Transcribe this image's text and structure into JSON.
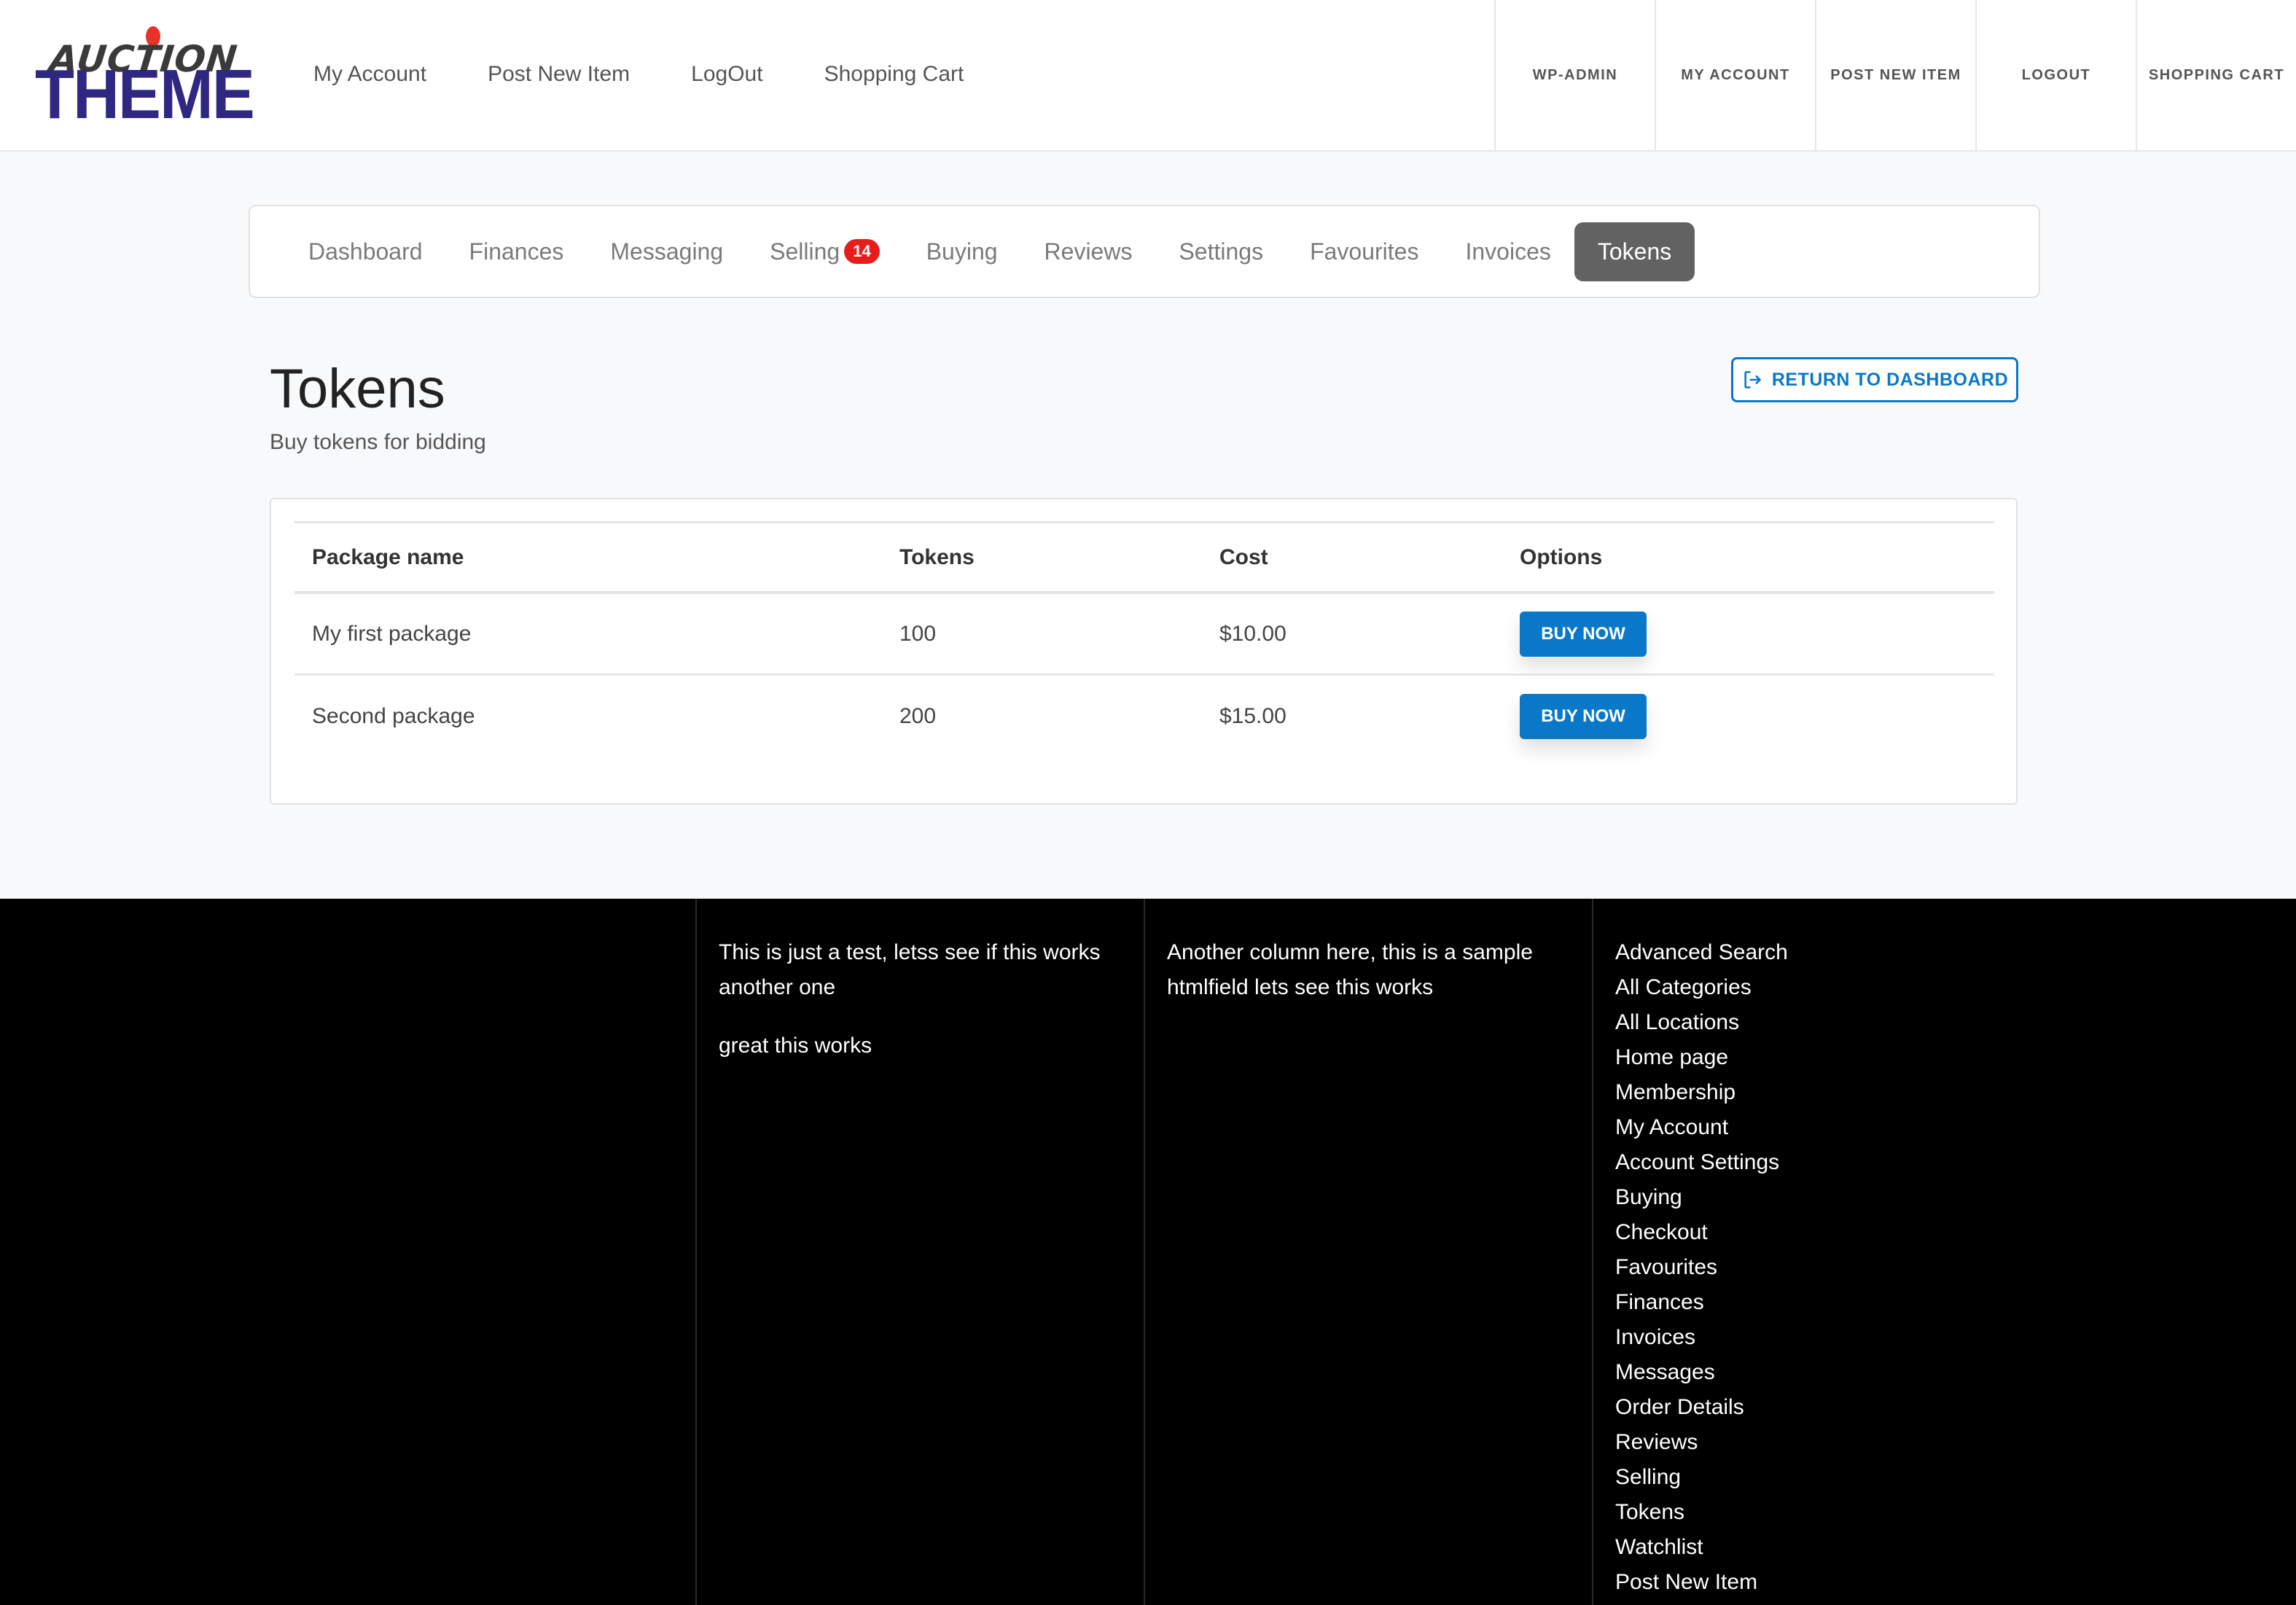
{
  "header": {
    "logo": {
      "top_text": "AUCTION",
      "bottom_text": "THEME",
      "accent_dot_color": "#e8322a",
      "brand_color": "#2f2782"
    },
    "main_links": [
      "My Account",
      "Post New Item",
      "LogOut",
      "Shopping Cart"
    ],
    "top_links": [
      "WP-ADMIN",
      "MY ACCOUNT",
      "POST NEW ITEM",
      "LOGOUT",
      "SHOPPING CART"
    ]
  },
  "tabs": {
    "items": [
      {
        "label": "Dashboard"
      },
      {
        "label": "Finances"
      },
      {
        "label": "Messaging"
      },
      {
        "label": "Selling",
        "badge": "14"
      },
      {
        "label": "Buying"
      },
      {
        "label": "Reviews"
      },
      {
        "label": "Settings"
      },
      {
        "label": "Favourites"
      },
      {
        "label": "Invoices"
      },
      {
        "label": "Tokens",
        "active": true
      }
    ],
    "active_color": "#626262",
    "badge_color": "#e71d1d"
  },
  "page": {
    "title": "Tokens",
    "subtitle": "Buy tokens for bidding",
    "return_button": "RETURN TO DASHBOARD",
    "return_icon": "sign-out-icon"
  },
  "table": {
    "columns": [
      "Package name",
      "Tokens",
      "Cost",
      "Options"
    ],
    "rows": [
      {
        "name": "My first package",
        "tokens": "100",
        "cost": "$10.00",
        "action": "BUY NOW"
      },
      {
        "name": "Second package",
        "tokens": "200",
        "cost": "$15.00",
        "action": "BUY NOW"
      }
    ],
    "button_color": "#0a78c8"
  },
  "footer": {
    "col1": {
      "paragraphs": [
        "This is just a test, letss see if this works another one",
        "great this works"
      ]
    },
    "col2": {
      "paragraphs": [
        "Another column here, this is a sample htmlfield lets see this works"
      ]
    },
    "col3": {
      "links": [
        "Advanced Search",
        "All Categories",
        "All Locations",
        "Home page",
        "Membership",
        "My Account",
        "Account Settings",
        "Buying",
        "Checkout",
        "Favourites",
        "Finances",
        "Invoices",
        "Messages",
        "Order Details",
        "Reviews",
        "Selling",
        "Tokens",
        "Watchlist",
        "Post New Item"
      ]
    }
  }
}
